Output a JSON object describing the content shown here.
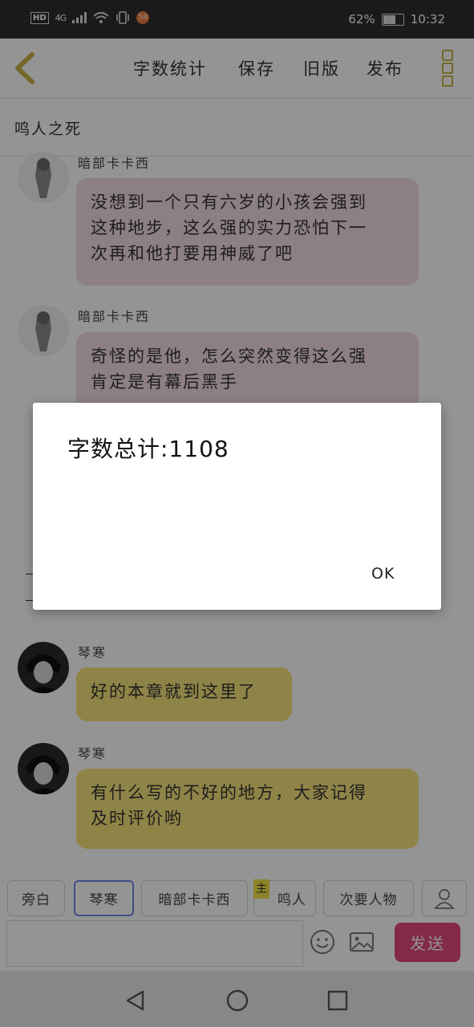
{
  "status_bar": {
    "hd": "HD",
    "network": "4G",
    "notification": "58",
    "battery": "62%",
    "battery_level": 0.62,
    "time": "10:32"
  },
  "toolbar": {
    "word_count": "字数统计",
    "save": "保存",
    "old_version": "旧版",
    "publish": "发布"
  },
  "story": {
    "title": "鸣人之死"
  },
  "messages": [
    {
      "sender": "暗部卡卡西",
      "text_lines": [
        "没想到一个只有六岁的小孩会强到",
        "这种地步，这么强的实力恐怕下一",
        "次再和他打要用神威了吧"
      ],
      "style": "pink"
    },
    {
      "sender": "暗部卡卡西",
      "text_lines": [
        "奇怪的是他，怎么突然变得这么强",
        "肯定是有幕后黑手"
      ],
      "style": "pink"
    },
    {
      "sender": "琴寒",
      "text_lines": [
        "好的本章就到这里了"
      ],
      "style": "yellow"
    },
    {
      "sender": "琴寒",
      "text_lines": [
        "有什么写的不好的地方，大家记得",
        "及时评价哟"
      ],
      "style": "yellow"
    }
  ],
  "characters": {
    "narration": "旁白",
    "qinhan": "琴寒",
    "kakashi": "暗部卡卡西",
    "naruto": "鸣人",
    "main_badge": "主",
    "minor": "次要人物"
  },
  "composer": {
    "send": "发送"
  },
  "dialog": {
    "message": "字数总计:1108",
    "ok": "OK"
  },
  "colors": {
    "accent_pink": "#e2477e",
    "bubble_pink": "#f3dde0",
    "bubble_yellow": "#f6e37a",
    "active_chip": "#6f86e8"
  }
}
